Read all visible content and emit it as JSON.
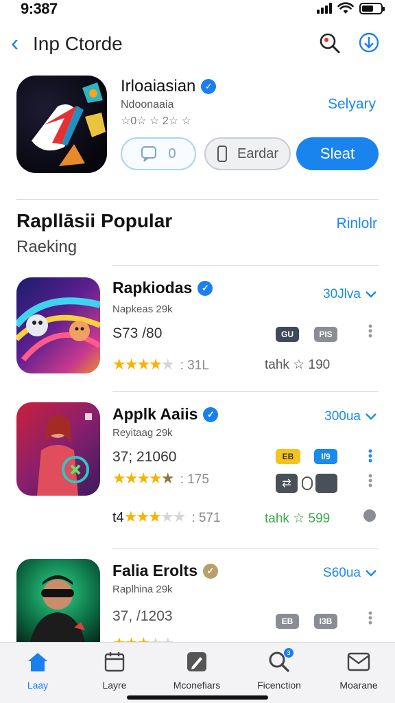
{
  "status": {
    "time": "9:387"
  },
  "nav": {
    "back": "‹",
    "title": "Inp Ctorde"
  },
  "featured": {
    "title": "Irloaiasian",
    "subtitle": "Ndoonaaia",
    "rating": "☆0☆ ☆ 2☆ ☆",
    "link": "Selyary",
    "btn_a": "0",
    "btn_b": "Eardar",
    "btn_c": "Sleat"
  },
  "section": {
    "title": "Rapllāsii Popular",
    "subtitle": "Raeking",
    "link": "Rinlolr"
  },
  "apps": [
    {
      "name": "Rapkiodas",
      "dev": "Napkeas 29k",
      "price": "S73 /80",
      "size": "30Jlva",
      "count": ": 31L",
      "tag1": "GU",
      "tag2": "PIS",
      "meta": "tahk ☆ 190"
    },
    {
      "name": "Applk Aaiis",
      "dev": "Reyitaag 29k",
      "price": "37; 21060",
      "size": "300ua",
      "count": ": 175",
      "tag1": "EB",
      "tag2": "I/9",
      "price2": "t4",
      "count2": ": 571",
      "meta": "tahk ☆ 599"
    },
    {
      "name": "Falia Erolts",
      "dev": "Raplhina 29k",
      "price": "37, /1203",
      "size": "S60ua",
      "tag1": "EB",
      "tag2": "I3B"
    }
  ],
  "tabs": [
    {
      "label": "Laay",
      "icon": "home-icon"
    },
    {
      "label": "Layre",
      "icon": "calendar-icon"
    },
    {
      "label": "Mconefiars",
      "icon": "pencil-icon"
    },
    {
      "label": "Ficenction",
      "icon": "search-icon",
      "badge": "3"
    },
    {
      "label": "Moarane",
      "icon": "mail-icon"
    }
  ],
  "colors": {
    "accent": "#1a7ff0",
    "star": "#f4b400",
    "green": "#3aa84a"
  }
}
